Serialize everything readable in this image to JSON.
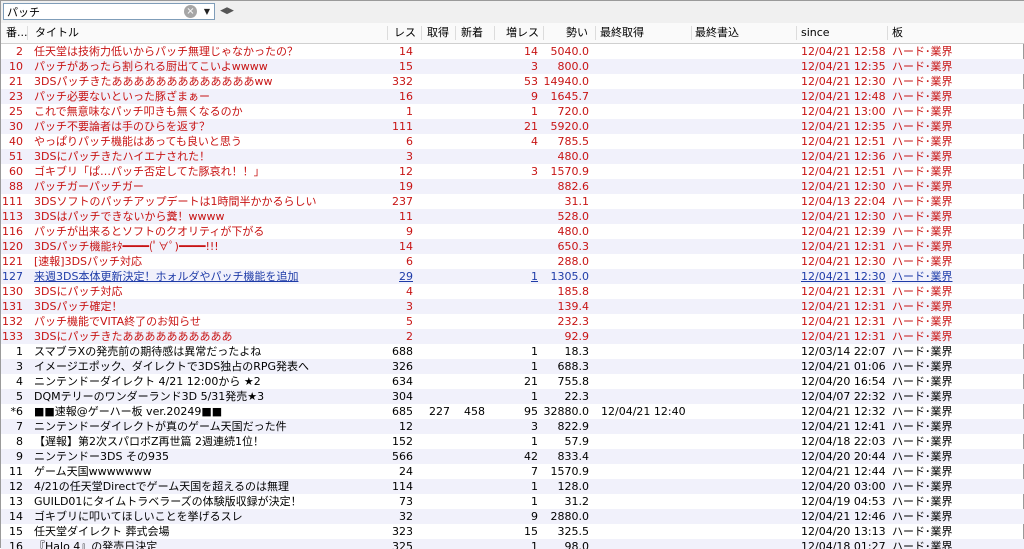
{
  "search": {
    "value": "パッチ"
  },
  "icons": {
    "clear": "×",
    "dropdown": "▼",
    "split": "◀▶"
  },
  "columns": {
    "no": "番...",
    "title": "タイトル",
    "res": "レス",
    "get": "取得",
    "new": "新着",
    "inc": "増レス",
    "mom": "勢い",
    "last_get": "最終取得",
    "last_write": "最終書込",
    "since": "since",
    "board": "板"
  },
  "rows": [
    {
      "no": "2",
      "title": "任天堂は技術力低いからパッチ無理じゃなかったの？",
      "res": "14",
      "get": "",
      "new": "",
      "inc": "14",
      "mom": "5040.0",
      "last": "",
      "since": "12/04/21 12:58",
      "board": "ハード･業界",
      "style": "red"
    },
    {
      "no": "10",
      "title": "パッチがあったら割られる厨出てこいよwwww",
      "res": "15",
      "get": "",
      "new": "",
      "inc": "3",
      "mom": "800.0",
      "last": "",
      "since": "12/04/21 12:35",
      "board": "ハード･業界",
      "style": "red"
    },
    {
      "no": "21",
      "title": "3DSパッチきたあああああああああああああww",
      "res": "332",
      "get": "",
      "new": "",
      "inc": "53",
      "mom": "14940.0",
      "last": "",
      "since": "12/04/21 12:30",
      "board": "ハード･業界",
      "style": "red"
    },
    {
      "no": "23",
      "title": "パッチ必要ないといった豚ざまぁー",
      "res": "16",
      "get": "",
      "new": "",
      "inc": "9",
      "mom": "1645.7",
      "last": "",
      "since": "12/04/21 12:48",
      "board": "ハード･業界",
      "style": "red"
    },
    {
      "no": "25",
      "title": "これで無意味なパッチ叩きも無くなるのか",
      "res": "1",
      "get": "",
      "new": "",
      "inc": "1",
      "mom": "720.0",
      "last": "",
      "since": "12/04/21 13:00",
      "board": "ハード･業界",
      "style": "red"
    },
    {
      "no": "30",
      "title": "パッチ不要論者は手のひらを返す？",
      "res": "111",
      "get": "",
      "new": "",
      "inc": "21",
      "mom": "5920.0",
      "last": "",
      "since": "12/04/21 12:35",
      "board": "ハード･業界",
      "style": "red"
    },
    {
      "no": "40",
      "title": "やっぱりパッチ機能はあっても良いと思う",
      "res": "6",
      "get": "",
      "new": "",
      "inc": "4",
      "mom": "785.5",
      "last": "",
      "since": "12/04/21 12:51",
      "board": "ハード･業界",
      "style": "red"
    },
    {
      "no": "51",
      "title": "3DSにパッチきたハイエナされた！",
      "res": "3",
      "get": "",
      "new": "",
      "inc": "",
      "mom": "480.0",
      "last": "",
      "since": "12/04/21 12:36",
      "board": "ハード･業界",
      "style": "red"
    },
    {
      "no": "60",
      "title": "ゴキブリ「ぱ…パッチ否定してた豚哀れ！！」",
      "res": "12",
      "get": "",
      "new": "",
      "inc": "3",
      "mom": "1570.9",
      "last": "",
      "since": "12/04/21 12:51",
      "board": "ハード･業界",
      "style": "red"
    },
    {
      "no": "88",
      "title": "パッチガーパッチガー",
      "res": "19",
      "get": "",
      "new": "",
      "inc": "",
      "mom": "882.6",
      "last": "",
      "since": "12/04/21 12:30",
      "board": "ハード･業界",
      "style": "red"
    },
    {
      "no": "111",
      "title": "3DSソフトのパッチアップデートは1時間半かかるらしい",
      "res": "237",
      "get": "",
      "new": "",
      "inc": "",
      "mom": "31.1",
      "last": "",
      "since": "12/04/13 22:04",
      "board": "ハード･業界",
      "style": "red"
    },
    {
      "no": "113",
      "title": "3DSはパッチできないから糞！wwww",
      "res": "11",
      "get": "",
      "new": "",
      "inc": "",
      "mom": "528.0",
      "last": "",
      "since": "12/04/21 12:30",
      "board": "ハード･業界",
      "style": "red"
    },
    {
      "no": "116",
      "title": "パッチが出来るとソフトのクオリティが下がる",
      "res": "9",
      "get": "",
      "new": "",
      "inc": "",
      "mom": "480.0",
      "last": "",
      "since": "12/04/21 12:39",
      "board": "ハード･業界",
      "style": "red"
    },
    {
      "no": "120",
      "title": "3DSパッチ機能ｷﾀ━━━━(ﾟ∀ﾟ)━━━━!!!",
      "res": "14",
      "get": "",
      "new": "",
      "inc": "",
      "mom": "650.3",
      "last": "",
      "since": "12/04/21 12:31",
      "board": "ハード･業界",
      "style": "red"
    },
    {
      "no": "121",
      "title": "[速報]3DSパッチ対応",
      "res": "6",
      "get": "",
      "new": "",
      "inc": "",
      "mom": "288.0",
      "last": "",
      "since": "12/04/21 12:30",
      "board": "ハード･業界",
      "style": "red"
    },
    {
      "no": "127",
      "title": "来週3DS本体更新決定！ホォルダやパッチ機能を追加",
      "res": "29",
      "get": "",
      "new": "",
      "inc": "1",
      "mom": "1305.0",
      "last": "",
      "since": "12/04/21 12:30",
      "board": "ハード･業界",
      "style": "blue"
    },
    {
      "no": "130",
      "title": "3DSにパッチ対応",
      "res": "4",
      "get": "",
      "new": "",
      "inc": "",
      "mom": "185.8",
      "last": "",
      "since": "12/04/21 12:31",
      "board": "ハード･業界",
      "style": "red"
    },
    {
      "no": "131",
      "title": "3DSパッチ確定！",
      "res": "3",
      "get": "",
      "new": "",
      "inc": "",
      "mom": "139.4",
      "last": "",
      "since": "12/04/21 12:31",
      "board": "ハード･業界",
      "style": "red"
    },
    {
      "no": "132",
      "title": "パッチ機能でVITA終了のお知らせ",
      "res": "5",
      "get": "",
      "new": "",
      "inc": "",
      "mom": "232.3",
      "last": "",
      "since": "12/04/21 12:31",
      "board": "ハード･業界",
      "style": "red"
    },
    {
      "no": "133",
      "title": "3DSにパッチきたああああああああああ",
      "res": "2",
      "get": "",
      "new": "",
      "inc": "",
      "mom": "92.9",
      "last": "",
      "since": "12/04/21 12:31",
      "board": "ハード･業界",
      "style": "red"
    },
    {
      "no": "1",
      "title": "スマブラXの発売前の期待感は異常だったよね",
      "res": "688",
      "get": "",
      "new": "",
      "inc": "1",
      "mom": "18.3",
      "last": "",
      "since": "12/03/14 22:07",
      "board": "ハード･業界",
      "style": "normal"
    },
    {
      "no": "3",
      "title": "イメージエポック、ダイレクトで3DS独占のRPG発表へ",
      "res": "326",
      "get": "",
      "new": "",
      "inc": "1",
      "mom": "688.3",
      "last": "",
      "since": "12/04/21 01:06",
      "board": "ハード･業界",
      "style": "normal"
    },
    {
      "no": "4",
      "title": "ニンテンドーダイレクト 4/21 12:00から ★2",
      "res": "634",
      "get": "",
      "new": "",
      "inc": "21",
      "mom": "755.8",
      "last": "",
      "since": "12/04/20 16:54",
      "board": "ハード･業界",
      "style": "normal"
    },
    {
      "no": "5",
      "title": "DQMテリーのワンダーランド3D 5/31発売★3",
      "res": "304",
      "get": "",
      "new": "",
      "inc": "1",
      "mom": "22.3",
      "last": "",
      "since": "12/04/07 22:32",
      "board": "ハード･業界",
      "style": "normal"
    },
    {
      "no": "*6",
      "title": "■■速報@ゲーハー板 ver.20249■■",
      "res": "685",
      "get": "227",
      "new": "458",
      "inc": "95",
      "mom": "32880.0",
      "last": "12/04/21 12:40",
      "since": "12/04/21 12:32",
      "board": "ハード･業界",
      "style": "normal"
    },
    {
      "no": "7",
      "title": "ニンテンドーダイレクトが真のゲーム天国だった件",
      "res": "12",
      "get": "",
      "new": "",
      "inc": "3",
      "mom": "822.9",
      "last": "",
      "since": "12/04/21 12:41",
      "board": "ハード･業界",
      "style": "normal"
    },
    {
      "no": "8",
      "title": "【遅報】第2次スパロボZ再世篇 2週連続1位！",
      "res": "152",
      "get": "",
      "new": "",
      "inc": "1",
      "mom": "57.9",
      "last": "",
      "since": "12/04/18 22:03",
      "board": "ハード･業界",
      "style": "normal"
    },
    {
      "no": "9",
      "title": "ニンテンドー3DS その935",
      "res": "566",
      "get": "",
      "new": "",
      "inc": "42",
      "mom": "833.4",
      "last": "",
      "since": "12/04/20 20:44",
      "board": "ハード･業界",
      "style": "normal"
    },
    {
      "no": "11",
      "title": "ゲーム天国wwwwwww",
      "res": "24",
      "get": "",
      "new": "",
      "inc": "7",
      "mom": "1570.9",
      "last": "",
      "since": "12/04/21 12:44",
      "board": "ハード･業界",
      "style": "normal"
    },
    {
      "no": "12",
      "title": "4/21の任天堂Directでゲーム天国を超えるのは無理",
      "res": "114",
      "get": "",
      "new": "",
      "inc": "1",
      "mom": "128.0",
      "last": "",
      "since": "12/04/20 03:00",
      "board": "ハード･業界",
      "style": "normal"
    },
    {
      "no": "13",
      "title": "GUILD01にタイムトラベラーズの体験版収録が決定！",
      "res": "73",
      "get": "",
      "new": "",
      "inc": "1",
      "mom": "31.2",
      "last": "",
      "since": "12/04/19 04:53",
      "board": "ハード･業界",
      "style": "normal"
    },
    {
      "no": "14",
      "title": "ゴキブリに叩いてほしいことを挙げるスレ",
      "res": "32",
      "get": "",
      "new": "",
      "inc": "9",
      "mom": "2880.0",
      "last": "",
      "since": "12/04/21 12:46",
      "board": "ハード･業界",
      "style": "normal"
    },
    {
      "no": "15",
      "title": "任天堂ダイレクト 葬式会場",
      "res": "323",
      "get": "",
      "new": "",
      "inc": "15",
      "mom": "325.5",
      "last": "",
      "since": "12/04/20 13:13",
      "board": "ハード･業界",
      "style": "normal"
    },
    {
      "no": "16",
      "title": "『Halo 4』の発売日決定",
      "res": "325",
      "get": "",
      "new": "",
      "inc": "1",
      "mom": "98.0",
      "last": "",
      "since": "12/04/18 01:27",
      "board": "ハード･業界",
      "style": "normal"
    }
  ]
}
